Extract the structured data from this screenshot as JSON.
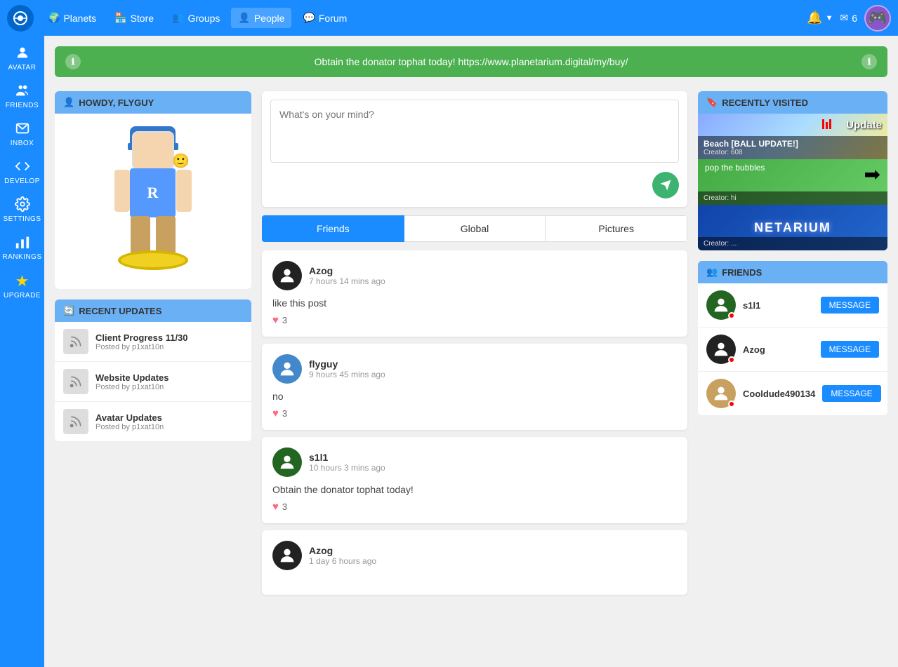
{
  "topnav": {
    "logo_alt": "Planetarium",
    "items": [
      {
        "label": "Planets",
        "icon": "planet-icon"
      },
      {
        "label": "Store",
        "icon": "store-icon"
      },
      {
        "label": "Groups",
        "icon": "groups-icon"
      },
      {
        "label": "People",
        "icon": "people-icon"
      },
      {
        "label": "Forum",
        "icon": "forum-icon"
      }
    ],
    "notifications_label": "🔔",
    "messages_label": "✉",
    "messages_count": "6"
  },
  "sidebar": {
    "items": [
      {
        "label": "AVATAR",
        "icon": "avatar-icon"
      },
      {
        "label": "FRIENDS",
        "icon": "friends-icon"
      },
      {
        "label": "INBOX",
        "icon": "inbox-icon"
      },
      {
        "label": "DEVELOP",
        "icon": "develop-icon"
      },
      {
        "label": "SETTINGS",
        "icon": "settings-icon"
      },
      {
        "label": "RANKINGS",
        "icon": "rankings-icon"
      },
      {
        "label": "UPGRADE",
        "icon": "upgrade-icon"
      }
    ]
  },
  "banner": {
    "text": "Obtain the donator tophat today! ",
    "link_text": "https://www.planetarium.digital/my/buy/",
    "link_href": "https://www.planetarium.digital/my/buy/"
  },
  "howdy_card": {
    "title": "HOWDY, FLYGUY",
    "user_icon": "person-icon"
  },
  "recent_updates": {
    "title": "RECENT UPDATES",
    "icon": "updates-icon",
    "items": [
      {
        "title": "Client Progress 11/30",
        "sub": "Posted by p1xat10n",
        "icon": "rss-icon"
      },
      {
        "title": "Website Updates",
        "sub": "Posted by p1xat10n",
        "icon": "rss-icon"
      },
      {
        "title": "Avatar Updates",
        "sub": "Posted by p1xat10n",
        "icon": "rss-icon"
      }
    ]
  },
  "post_box": {
    "placeholder": "What's on your mind?"
  },
  "feed_tabs": [
    {
      "label": "Friends",
      "active": true
    },
    {
      "label": "Global",
      "active": false
    },
    {
      "label": "Pictures",
      "active": false
    }
  ],
  "feed_posts": [
    {
      "user": "Azog",
      "time": "7 hours 14 mins ago",
      "content": "like this post",
      "likes": "3",
      "avatar_type": "azog"
    },
    {
      "user": "flyguy",
      "time": "9 hours 45 mins ago",
      "content": "no",
      "likes": "3",
      "avatar_type": "flyguy"
    },
    {
      "user": "s1l1",
      "time": "10 hours 3 mins ago",
      "content": "Obtain the donator tophat today!",
      "likes": "3",
      "avatar_type": "s1l1"
    },
    {
      "user": "Azog",
      "time": "1 day 6 hours ago",
      "content": "",
      "likes": "",
      "avatar_type": "azog"
    }
  ],
  "recently_visited": {
    "title": "RECENTLY VISITED",
    "icon": "bookmark-icon",
    "items": [
      {
        "name": "Beach [BALL UPDATE!]",
        "creator": "Creator: 608"
      },
      {
        "name": "pop the bubbles",
        "creator": "Creator: hi"
      },
      {
        "name": "NETARIUM",
        "creator": "Creator: ..."
      }
    ]
  },
  "friends": {
    "title": "FRIENDS",
    "icon": "friends-icon",
    "items": [
      {
        "name": "s1l1",
        "btn_label": "MESSAGE",
        "avatar_type": "green"
      },
      {
        "name": "Azog",
        "btn_label": "MESSAGE",
        "avatar_type": "dark"
      },
      {
        "name": "Cooldude490134",
        "btn_label": "MESSAGE",
        "avatar_type": "tan"
      }
    ]
  }
}
